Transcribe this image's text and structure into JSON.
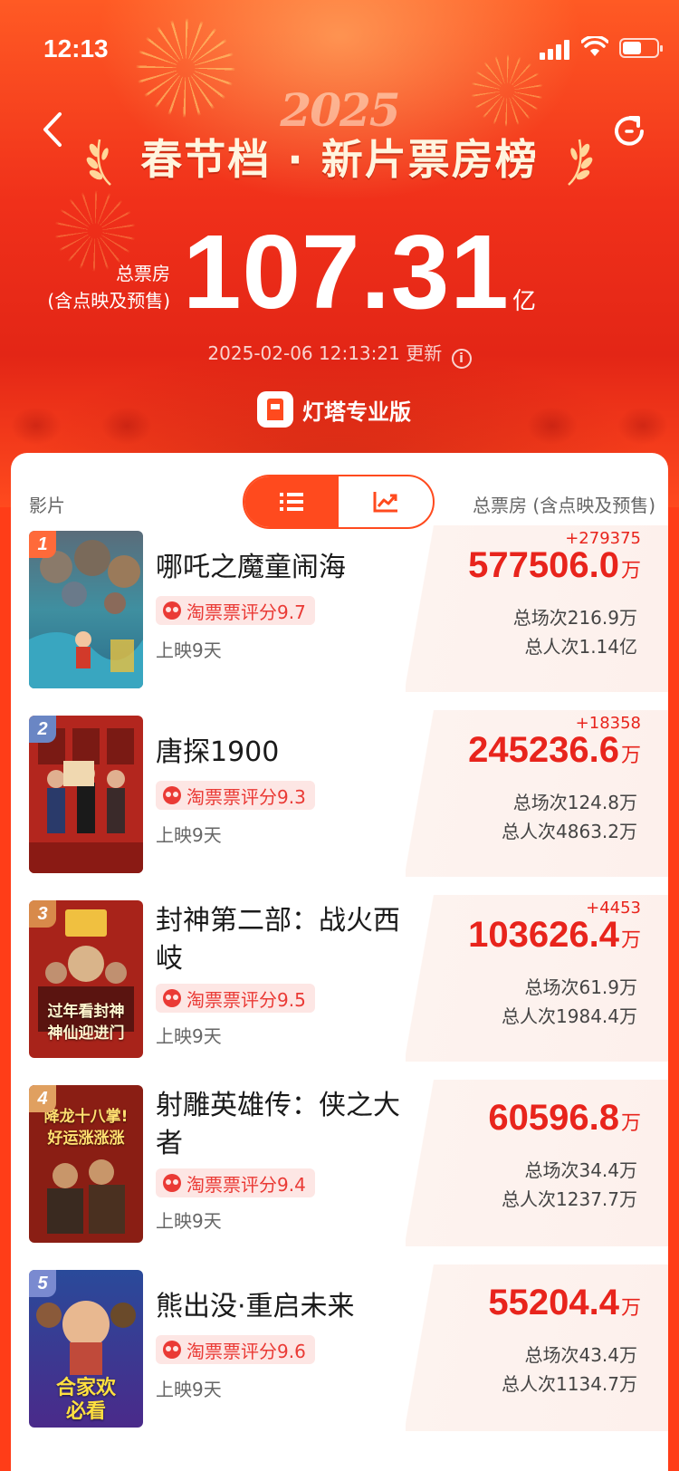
{
  "status_bar": {
    "time": "12:13",
    "battery_level": 0.55
  },
  "header": {
    "year": "2025",
    "title": "春节档 · 新片票房榜",
    "total_label_line1": "总票房",
    "total_label_line2": "(含点映及预售)",
    "total_value": "107.31",
    "total_unit": "亿",
    "update_time": "2025-02-06 12:13:21 更新",
    "brand": "灯塔专业版"
  },
  "list_header": {
    "film_col": "影片",
    "box_col": "总票房 (含点映及预售)"
  },
  "colors": {
    "accent": "#ff4a1e",
    "red_text": "#e8241c",
    "rating_bg": "#fde6e4"
  },
  "films": [
    {
      "rank": "1",
      "name": "哪吒之魔童闹海",
      "rating": "淘票票评分9.7",
      "days": "上映9天",
      "delta": "+279375",
      "box": "577506.0",
      "unit": "万",
      "sessions": "总场次216.9万",
      "people": "总人次1.14亿"
    },
    {
      "rank": "2",
      "name": "唐探1900",
      "rating": "淘票票评分9.3",
      "days": "上映9天",
      "delta": "+18358",
      "box": "245236.6",
      "unit": "万",
      "sessions": "总场次124.8万",
      "people": "总人次4863.2万"
    },
    {
      "rank": "3",
      "name": "封神第二部：战火西岐",
      "rating": "淘票票评分9.5",
      "days": "上映9天",
      "delta": "+4453",
      "box": "103626.4",
      "unit": "万",
      "sessions": "总场次61.9万",
      "people": "总人次1984.4万"
    },
    {
      "rank": "4",
      "name": "射雕英雄传：侠之大者",
      "rating": "淘票票评分9.4",
      "days": "上映9天",
      "delta": "",
      "box": "60596.8",
      "unit": "万",
      "sessions": "总场次34.4万",
      "people": "总人次1237.7万"
    },
    {
      "rank": "5",
      "name": "熊出没·重启未来",
      "rating": "淘票票评分9.6",
      "days": "上映9天",
      "delta": "",
      "box": "55204.4",
      "unit": "万",
      "sessions": "总场次43.4万",
      "people": "总人次1134.7万"
    }
  ],
  "posters": {
    "p3_line1": "过年看封神",
    "p3_line2": "神仙迎进门",
    "p4_line1": "降龙十八掌!",
    "p4_line2": "好运涨涨涨",
    "p5_line1": "合家欢",
    "p5_line2": "必看"
  }
}
